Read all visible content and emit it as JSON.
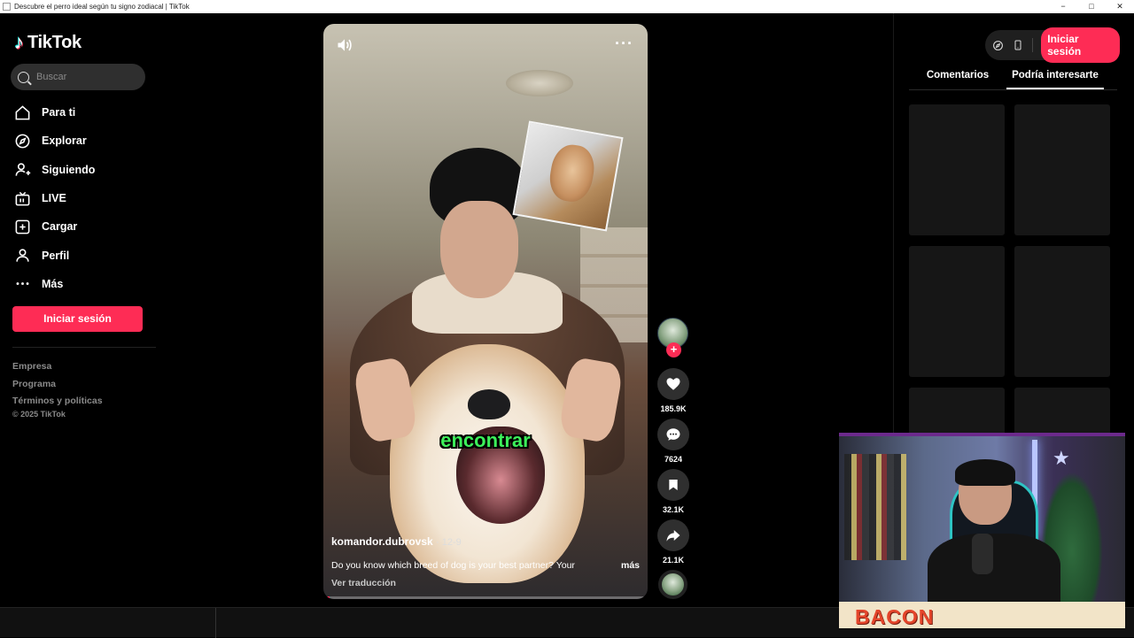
{
  "window": {
    "title": "Descubre el perro ideal según tu signo zodiacal | TikTok",
    "controls": [
      "−",
      "□",
      "✕"
    ]
  },
  "sidebar": {
    "brand": "TikTok",
    "search_placeholder": "Buscar",
    "nav": [
      {
        "label": "Para ti",
        "icon": "home-icon"
      },
      {
        "label": "Explorar",
        "icon": "compass-icon"
      },
      {
        "label": "Siguiendo",
        "icon": "following-icon"
      },
      {
        "label": "LIVE",
        "icon": "live-icon"
      },
      {
        "label": "Cargar",
        "icon": "upload-icon"
      },
      {
        "label": "Perfil",
        "icon": "profile-icon"
      },
      {
        "label": "Más",
        "icon": "more-icon"
      }
    ],
    "login_label": "Iniciar sesión",
    "footer_links": [
      "Empresa",
      "Programa",
      "Términos y políticas"
    ],
    "copyright": "© 2025 TikTok"
  },
  "video": {
    "caption_word": "encontrar",
    "author": "komandor.dubrovsk",
    "date": "· 12-9",
    "description": "Do you know which breed of dog is your best partner? Your",
    "more_label": "más",
    "translate_label": "Ver traducción",
    "progress": 0.02
  },
  "actions": {
    "likes": "185.9K",
    "comments": "7624",
    "saves": "32.1K",
    "shares": "21.1K"
  },
  "right_panel": {
    "login_label": "Iniciar sesión",
    "tabs": [
      "Comentarios",
      "Podría interesarte"
    ],
    "active_tab": 1
  },
  "webcam": {
    "overlay_text": "BACON"
  },
  "colors": {
    "brand_accent": "#fe2c55",
    "caption_green": "#3cf05a"
  }
}
